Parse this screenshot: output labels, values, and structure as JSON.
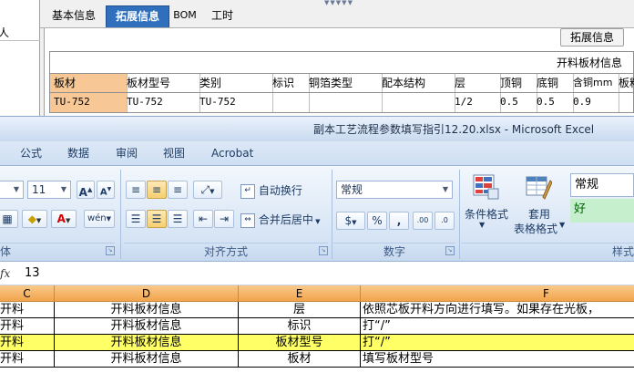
{
  "bg_app": {
    "tree_text": "人",
    "tabs": [
      {
        "label": "基本信息",
        "active": false
      },
      {
        "label": "拓展信息",
        "active": true
      },
      {
        "label": "BOM",
        "active": false
      },
      {
        "label": "工时",
        "active": false
      }
    ],
    "expand_button": "拓展信息",
    "grid_title": "开料板材信息",
    "columns": [
      "板材",
      "板材型号",
      "类别",
      "标识",
      "铜箔类型",
      "配本结构",
      "层",
      "顶铜",
      "底铜",
      "含铜mm",
      "板料"
    ],
    "row": [
      "TU-752",
      "TU-752",
      "TU-752",
      "",
      "",
      "",
      "1/2",
      "0.5",
      "0.5",
      "0.9",
      ""
    ]
  },
  "excel": {
    "title": "副本工艺流程参数填写指引12.20.xlsx - Microsoft Excel",
    "ribbon_tabs": [
      "公式",
      "数据",
      "审阅",
      "视图",
      "Acrobat"
    ],
    "font_size": "11",
    "wrap_text": "自动换行",
    "merge_center": "合并后居中",
    "number_format": "常规",
    "percent": "%",
    "comma": ",",
    "conditional_format": "条件格式",
    "table_format_line1": "套用",
    "table_format_line2": "表格格式",
    "style_normal": "常规",
    "style_good": "好",
    "group_font": "体",
    "group_align": "对齐方式",
    "group_number": "数字",
    "group_style": "样式",
    "formula_label": "fx",
    "formula_value": "13",
    "col_headers": [
      "C",
      "D",
      "E",
      "F"
    ],
    "rows": [
      {
        "c": "开料",
        "d": "开料板材信息",
        "e": "层",
        "f": "依照芯板开料方向进行填写。如果存在光板，",
        "highlight": false
      },
      {
        "c": "开料",
        "d": "开料板材信息",
        "e": "标识",
        "f": "打“/”",
        "highlight": false
      },
      {
        "c": "开料",
        "d": "开料板材信息",
        "e": "板材型号",
        "f": "打“/”",
        "highlight": true
      },
      {
        "c": "开料",
        "d": "开料板材信息",
        "e": "板材",
        "f": "填写板材型号",
        "highlight": false
      }
    ],
    "colors": {
      "header_orange": "#f2a54d",
      "highlight_yellow": "#ffff66",
      "tab_blue": "#2f6fbc",
      "cell_orange": "#f7c896"
    }
  }
}
